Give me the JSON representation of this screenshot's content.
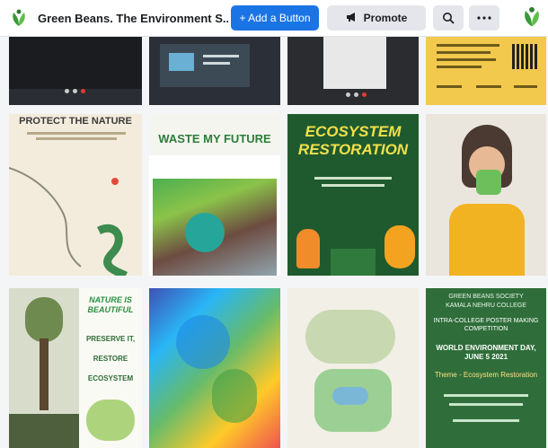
{
  "header": {
    "page_title": "Green Beans. The Environment S...",
    "add_button_label": "+ Add a Button",
    "promote_label": "Promote",
    "search_icon": "search-icon",
    "more_icon": "more-icon"
  },
  "photos": {
    "row1": [
      {
        "desc": "video-call-screenshot-1"
      },
      {
        "desc": "video-call-screenshot-2"
      },
      {
        "desc": "video-call-screenshot-3"
      },
      {
        "desc": "event-poster-with-qr"
      }
    ],
    "poster_a_title": "PROTECT THE NATURE",
    "poster_b_title": "WASTE MY FUTURE",
    "poster_c_title": "ECOSYSTEM RESTORATION",
    "poster_e_title": "NATURE IS BEAUTIFUL",
    "poster_e_line1": "PRESERVE IT,",
    "poster_e_line2": "RESTORE",
    "poster_e_line3": "ECOSYSTEM",
    "poster_h_line1": "GREEN BEANS SOCIETY",
    "poster_h_line2": "KAMALA NEHRU COLLEGE",
    "poster_h_line3": "INTRA-COLLEGE POSTER MAKING COMPETITION",
    "poster_h_line4": "WORLD ENVIRONMENT DAY, JUNE 5 2021",
    "poster_h_line5": "Theme - Ecosystem Restoration"
  },
  "colors": {
    "accent": "#1b74e4",
    "poster_green_dark": "#1f5a2e",
    "poster_green": "#2f7a3c"
  }
}
